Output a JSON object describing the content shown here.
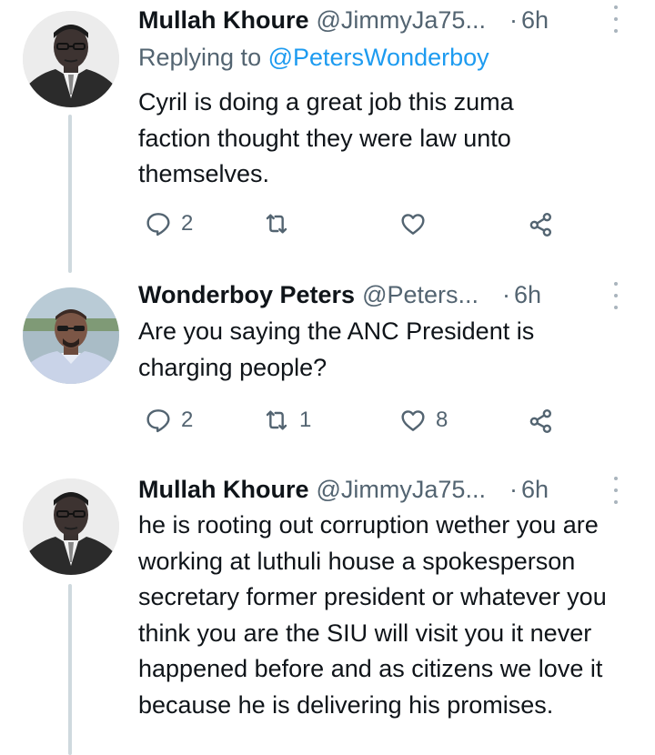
{
  "tweets": [
    {
      "name": "Mullah Khoure",
      "handle": "@JimmyJa75...",
      "dot": "·",
      "time": "6h",
      "replying_prefix": "Replying to",
      "replying_to": "@PetersWonderboy",
      "text": "Cyril is doing a great job this zuma faction thought they were law unto themselves.",
      "replies": "2",
      "retweets": "",
      "likes": ""
    },
    {
      "name": "Wonderboy Peters",
      "handle": "@Peters...",
      "dot": "·",
      "time": "6h",
      "text": "Are you saying the ANC President is charging people?",
      "replies": "2",
      "retweets": "1",
      "likes": "8"
    },
    {
      "name": "Mullah Khoure",
      "handle": "@JimmyJa75...",
      "dot": "·",
      "time": "6h",
      "text": "he is rooting out corruption wether you are working at luthuli house a spokesperson secretary former president or whatever you think you are the SIU will visit you it never happened before and as citizens we love it because he is delivering his promises."
    }
  ],
  "icons": {
    "reply": "reply-icon",
    "retweet": "retweet-icon",
    "like": "heart-icon",
    "share": "share-icon",
    "more": "more-vertical-icon"
  },
  "colors": {
    "text": "#0f1419",
    "secondary": "#536471",
    "link": "#1d9bf0",
    "thread_line": "#cfd9de"
  }
}
